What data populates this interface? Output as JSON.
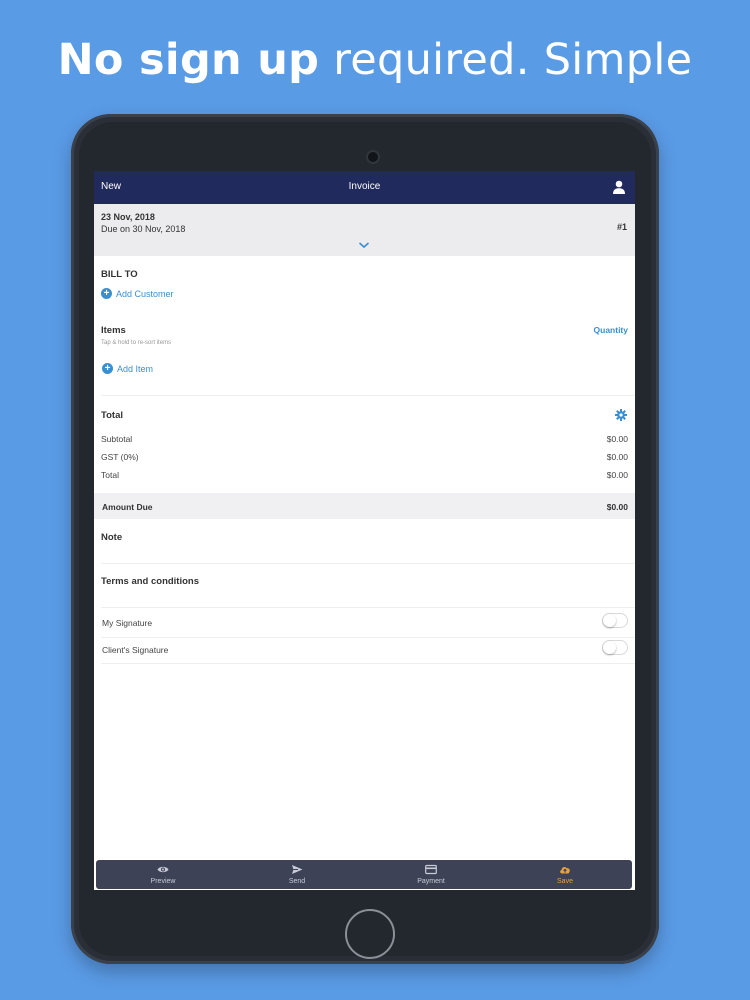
{
  "headline": {
    "bold": "No sign up",
    "rest": " required. Simple"
  },
  "nav": {
    "left": "New",
    "title": "Invoice",
    "user_icon": "user-icon"
  },
  "invoice_header": {
    "date": "23 Nov, 2018",
    "due": "Due on 30 Nov, 2018",
    "number": "#1"
  },
  "bill_to": {
    "title": "BILL TO",
    "add_customer": "Add Customer"
  },
  "items": {
    "title": "Items",
    "hint": "Tap & hold to re-sort items",
    "quantity": "Quantity",
    "add_item": "Add Item"
  },
  "totals": {
    "title": "Total",
    "rows": [
      {
        "label": "Subtotal",
        "value": "$0.00"
      },
      {
        "label": "GST (0%)",
        "value": "$0.00"
      },
      {
        "label": "Total",
        "value": "$0.00"
      }
    ],
    "amount_due_label": "Amount Due",
    "amount_due_value": "$0.00"
  },
  "note": {
    "title": "Note"
  },
  "terms": {
    "title": "Terms and conditions"
  },
  "signatures": [
    {
      "label": "My Signature",
      "enabled": false
    },
    {
      "label": "Client's Signature",
      "enabled": false
    }
  ],
  "tabbar": [
    {
      "label": "Preview",
      "icon": "eye-icon",
      "active": false
    },
    {
      "label": "Send",
      "icon": "send-icon",
      "active": false
    },
    {
      "label": "Payment",
      "icon": "card-icon",
      "active": false
    },
    {
      "label": "Save",
      "icon": "cloud-upload-icon",
      "active": true
    }
  ],
  "colors": {
    "background": "#5a9be6",
    "nav": "#212a5c",
    "accent": "#3a8fd0",
    "save_active": "#e9a23b",
    "tabbar": "#3d4257"
  }
}
